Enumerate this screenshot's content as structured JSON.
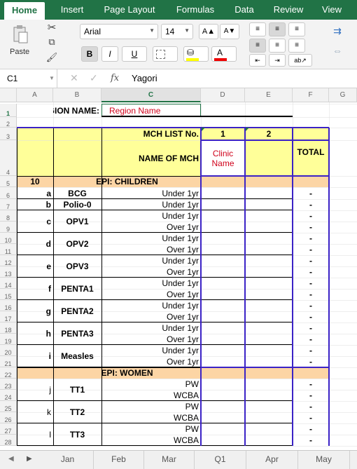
{
  "tabs": [
    "Home",
    "Insert",
    "Page Layout",
    "Formulas",
    "Data",
    "Review",
    "View"
  ],
  "ribbon": {
    "paste_label": "Paste",
    "font_name": "Arial",
    "font_size": "14",
    "bold": "B",
    "italic": "I",
    "underline": "U",
    "grow": "A▲",
    "shrink": "A▼",
    "font_color_letter": "A",
    "fill_icon": "paint-bucket-icon"
  },
  "formula_bar": {
    "cell_ref": "C1",
    "fx": "fx",
    "value": "Yagori"
  },
  "columns": [
    "A",
    "B",
    "C",
    "D",
    "E",
    "F",
    "G"
  ],
  "rows": [
    "1",
    "2",
    "3",
    "4",
    "5",
    "6",
    "7",
    "8",
    "9",
    "10",
    "11",
    "12",
    "13",
    "14",
    "15",
    "16",
    "17",
    "18",
    "19",
    "20",
    "21",
    "22",
    "23",
    "24",
    "25",
    "26",
    "27",
    "28"
  ],
  "sheet": {
    "region_label": "REGION NAME:",
    "region_value": "Region Name",
    "mch_list_label": "MCH LIST No.",
    "mch1": "1",
    "mch2": "2",
    "name_of_mch": "NAME OF MCH",
    "clinic_line1": "Clinic",
    "clinic_line2": "Name",
    "total": "TOTAL",
    "ten": "10",
    "epi_children": "EPI: CHILDREN",
    "epi_women": "EPI: WOMEN",
    "dash": "-",
    "children": [
      {
        "letter": "a",
        "vaccine": "BCG",
        "ages": [
          "Under 1yr"
        ]
      },
      {
        "letter": "b",
        "vaccine": "Polio-0",
        "ages": [
          "Under 1yr"
        ]
      },
      {
        "letter": "c",
        "vaccine": "OPV1",
        "ages": [
          "Under 1yr",
          "Over 1yr"
        ]
      },
      {
        "letter": "d",
        "vaccine": "OPV2",
        "ages": [
          "Under 1yr",
          "Over 1yr"
        ]
      },
      {
        "letter": "e",
        "vaccine": "OPV3",
        "ages": [
          "Under 1yr",
          "Over 1yr"
        ]
      },
      {
        "letter": "f",
        "vaccine": "PENTA1",
        "ages": [
          "Under 1yr",
          "Over 1yr"
        ]
      },
      {
        "letter": "g",
        "vaccine": "PENTA2",
        "ages": [
          "Under 1yr",
          "Over 1yr"
        ]
      },
      {
        "letter": "h",
        "vaccine": "PENTA3",
        "ages": [
          "Under 1yr",
          "Over 1yr"
        ]
      },
      {
        "letter": "i",
        "vaccine": "Measles",
        "ages": [
          "Under 1yr",
          "Over 1yr"
        ]
      }
    ],
    "women": [
      {
        "letter": "j",
        "vaccine": "TT1",
        "ages": [
          "PW",
          "WCBA"
        ]
      },
      {
        "letter": "k",
        "vaccine": "TT2",
        "ages": [
          "PW",
          "WCBA"
        ]
      },
      {
        "letter": "l",
        "vaccine": "TT3",
        "ages": [
          "PW",
          "WCBA"
        ]
      }
    ]
  },
  "sheet_tabs": [
    "Jan",
    "Feb",
    "Mar",
    "Q1",
    "Apr",
    "May"
  ]
}
